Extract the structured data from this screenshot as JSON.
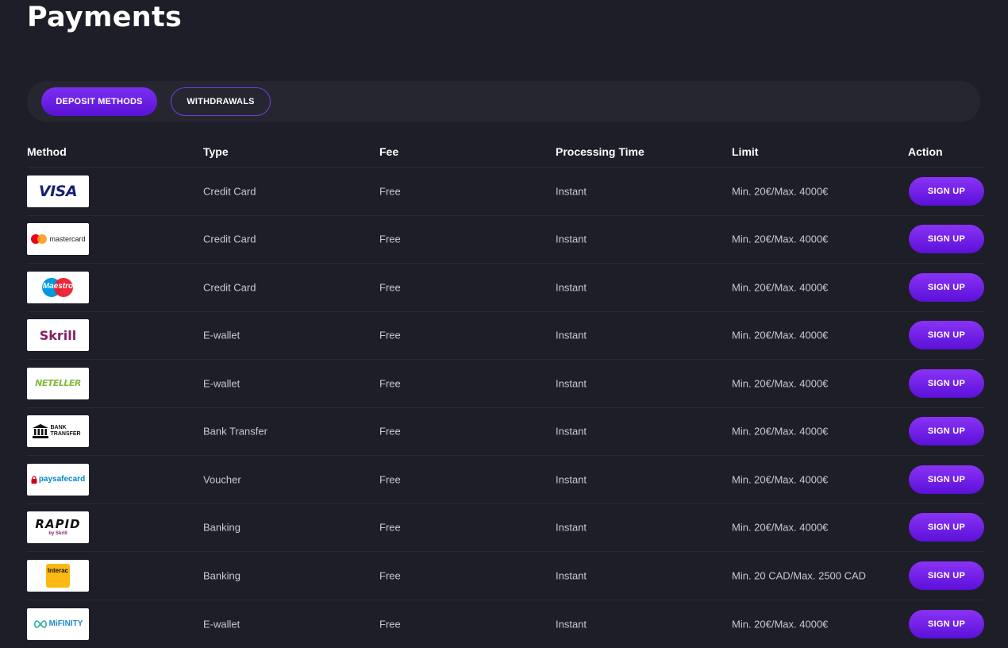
{
  "page": {
    "title": "Payments"
  },
  "tabs": [
    {
      "label": "DEPOSIT METHODS",
      "active": true
    },
    {
      "label": "WITHDRAWALS",
      "active": false
    }
  ],
  "table": {
    "headers": [
      "Method",
      "Type",
      "Fee",
      "Processing Time",
      "Limit",
      "Action"
    ],
    "rows": [
      {
        "logo": "visa-logo",
        "logo_text": "VISA",
        "type": "Credit Card",
        "fee": "Free",
        "time": "Instant",
        "limit": "Min. 20€/Max. 4000€",
        "action": "SIGN UP"
      },
      {
        "logo": "mastercard-logo",
        "logo_text": "mastercard",
        "type": "Credit Card",
        "fee": "Free",
        "time": "Instant",
        "limit": "Min. 20€/Max. 4000€",
        "action": "SIGN UP"
      },
      {
        "logo": "maestro-logo",
        "logo_text": "Maestro",
        "type": "Credit Card",
        "fee": "Free",
        "time": "Instant",
        "limit": "Min. 20€/Max. 4000€",
        "action": "SIGN UP"
      },
      {
        "logo": "skrill-logo",
        "logo_text": "Skrill",
        "type": "E-wallet",
        "fee": "Free",
        "time": "Instant",
        "limit": "Min. 20€/Max. 4000€",
        "action": "SIGN UP"
      },
      {
        "logo": "neteller-logo",
        "logo_text": "NETELLER",
        "type": "E-wallet",
        "fee": "Free",
        "time": "Instant",
        "limit": "Min. 20€/Max. 4000€",
        "action": "SIGN UP"
      },
      {
        "logo": "bank-transfer-logo",
        "logo_text": "BANK TRANSFER",
        "type": "Bank Transfer",
        "fee": "Free",
        "time": "Instant",
        "limit": "Min. 20€/Max. 4000€",
        "action": "SIGN UP"
      },
      {
        "logo": "paysafecard-logo",
        "logo_text": "paysafecard",
        "type": "Voucher",
        "fee": "Free",
        "time": "Instant",
        "limit": "Min. 20€/Max. 4000€",
        "action": "SIGN UP"
      },
      {
        "logo": "rapid-logo",
        "logo_text": "RAPID",
        "logo_sub": "by Skrill",
        "type": "Banking",
        "fee": "Free",
        "time": "Instant",
        "limit": "Min. 20€/Max. 4000€",
        "action": "SIGN UP"
      },
      {
        "logo": "interac-logo",
        "logo_text": "Interac",
        "type": "Banking",
        "fee": "Free",
        "time": "Instant",
        "limit": "Min. 20 CAD/Max. 2500 CAD",
        "action": "SIGN UP"
      },
      {
        "logo": "mifinity-logo",
        "logo_text": "MiFINITY",
        "type": "E-wallet",
        "fee": "Free",
        "time": "Instant",
        "limit": "Min. 20€/Max. 4000€",
        "action": "SIGN UP"
      }
    ]
  },
  "colors": {
    "background": "#1d1e27",
    "accent": "#6a1fe6",
    "tab_bar": "#252630"
  }
}
